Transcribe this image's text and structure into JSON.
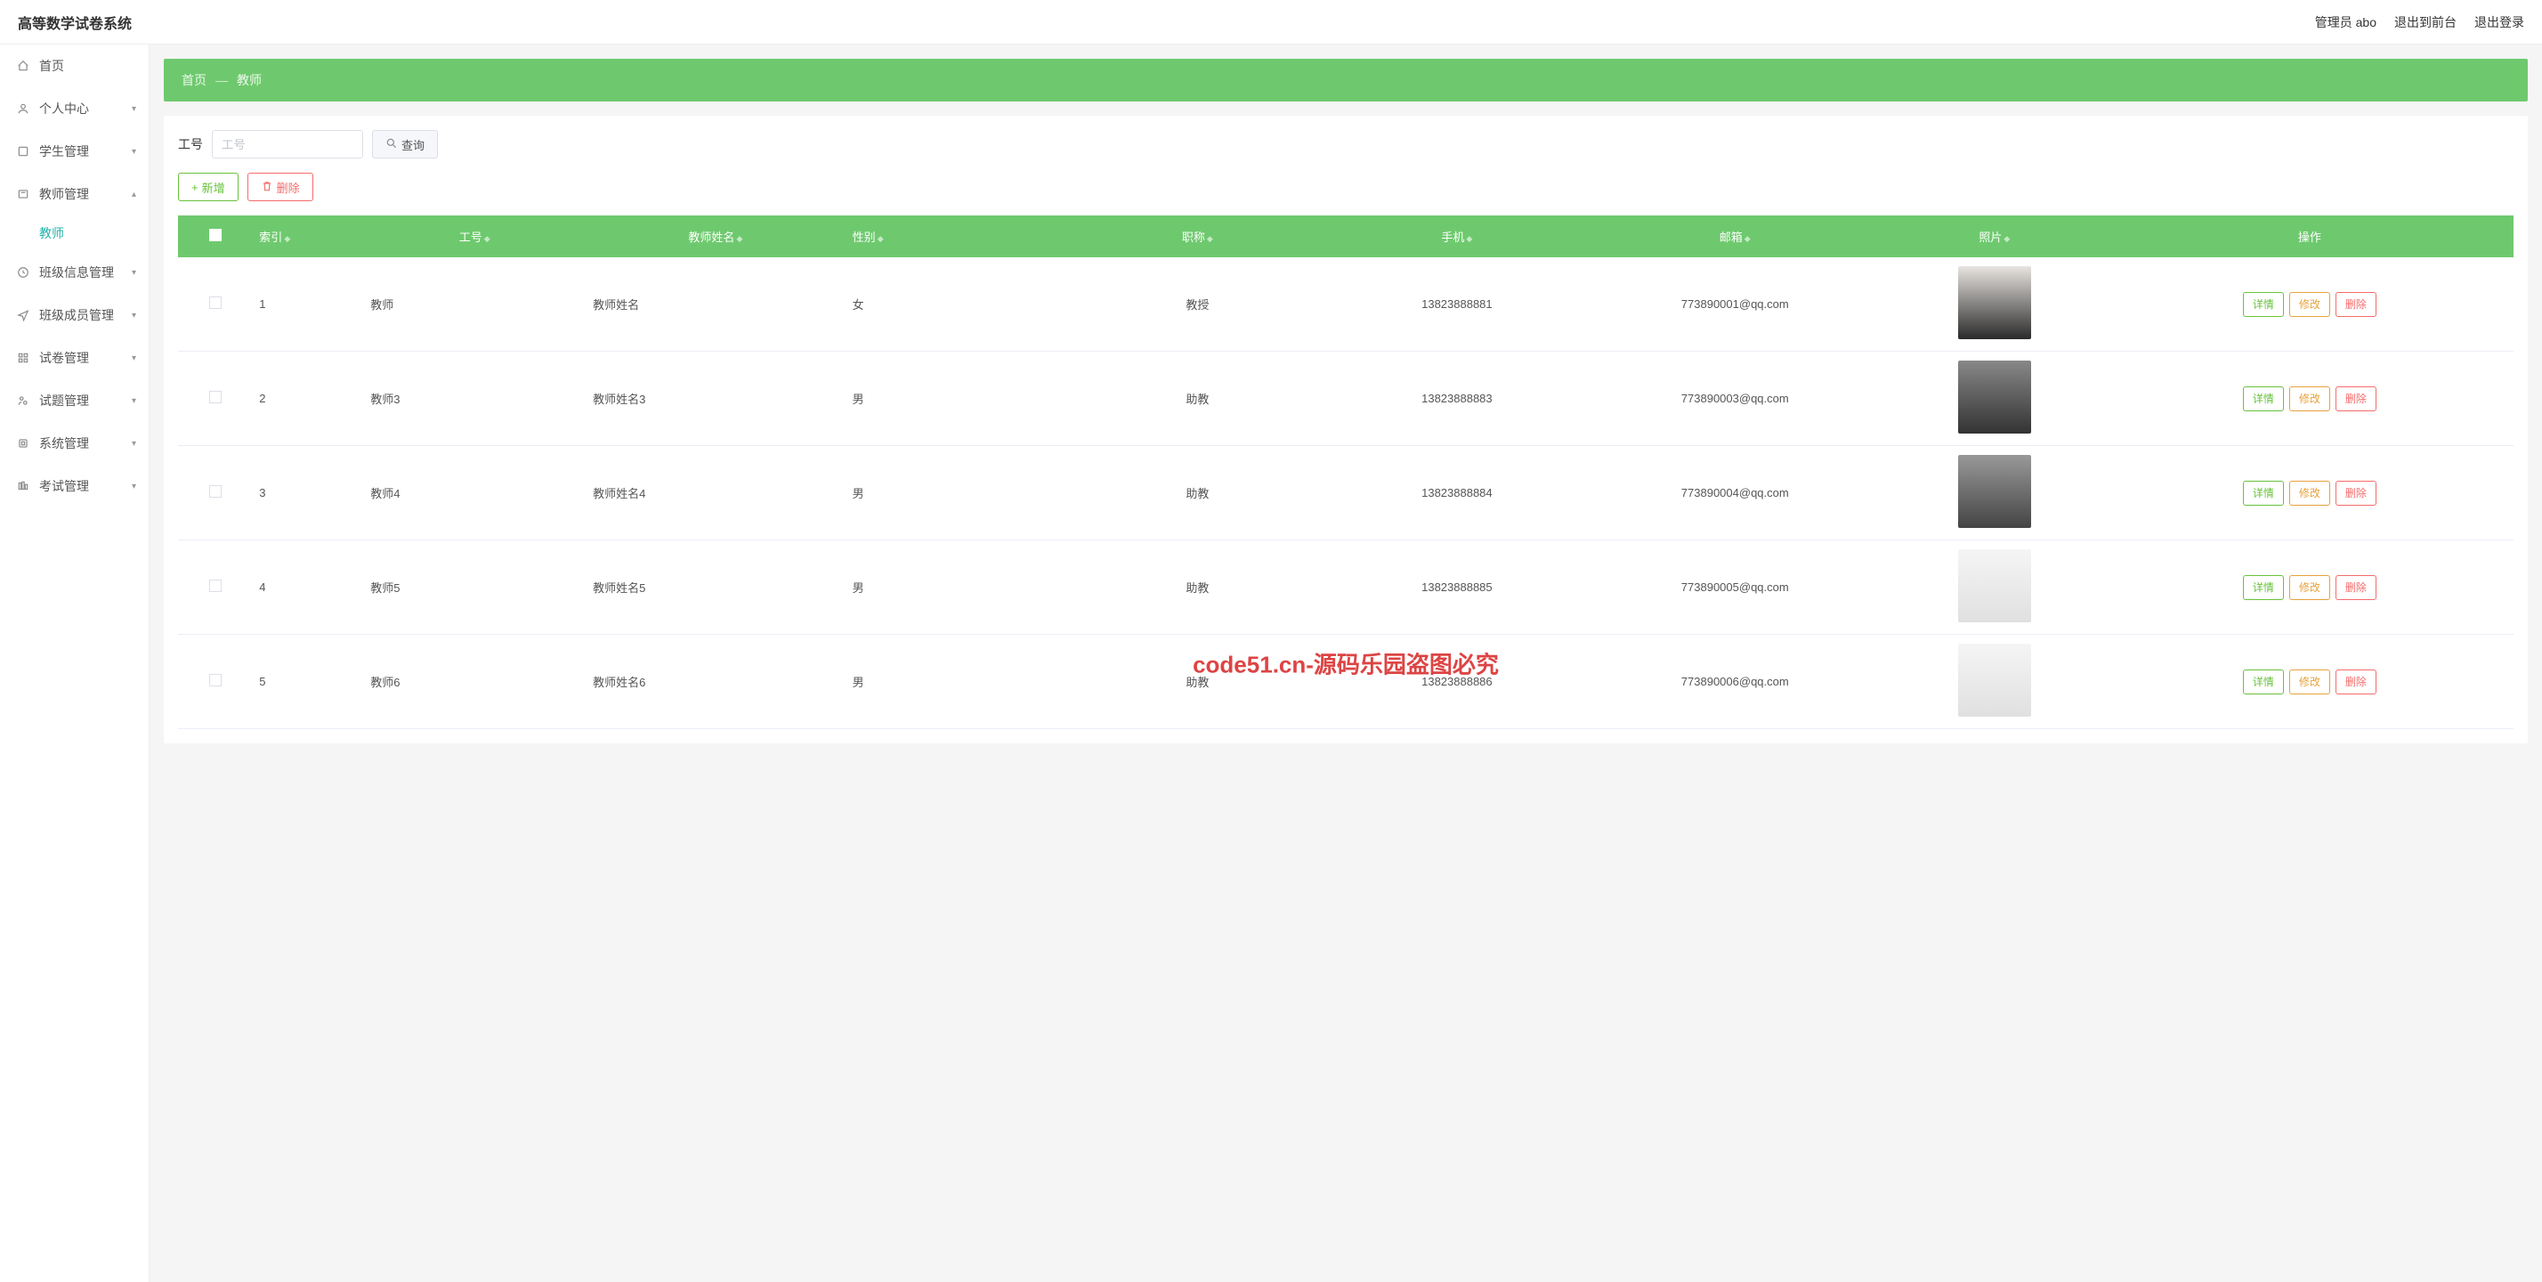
{
  "header": {
    "title": "高等数学试卷系统",
    "admin_label": "管理员 abo",
    "exit_front": "退出到前台",
    "logout": "退出登录"
  },
  "sidebar": {
    "items": [
      {
        "label": "首页",
        "icon": "home-icon",
        "expandable": false
      },
      {
        "label": "个人中心",
        "icon": "user-icon",
        "expandable": true,
        "expanded": false
      },
      {
        "label": "学生管理",
        "icon": "student-icon",
        "expandable": true,
        "expanded": false
      },
      {
        "label": "教师管理",
        "icon": "teacher-icon",
        "expandable": true,
        "expanded": true,
        "children": [
          {
            "label": "教师"
          }
        ]
      },
      {
        "label": "班级信息管理",
        "icon": "class-icon",
        "expandable": true,
        "expanded": false
      },
      {
        "label": "班级成员管理",
        "icon": "member-icon",
        "expandable": true,
        "expanded": false
      },
      {
        "label": "试卷管理",
        "icon": "paper-icon",
        "expandable": true,
        "expanded": false
      },
      {
        "label": "试题管理",
        "icon": "question-icon",
        "expandable": true,
        "expanded": false
      },
      {
        "label": "系统管理",
        "icon": "system-icon",
        "expandable": true,
        "expanded": false
      },
      {
        "label": "考试管理",
        "icon": "exam-icon",
        "expandable": true,
        "expanded": false
      }
    ]
  },
  "breadcrumb": {
    "home": "首页",
    "current": "教师"
  },
  "search": {
    "label": "工号",
    "placeholder": "工号",
    "btn": "查询"
  },
  "actions": {
    "add": "新增",
    "delete": "删除"
  },
  "table": {
    "headers": [
      "索引",
      "工号",
      "教师姓名",
      "性别",
      "职称",
      "手机",
      "邮箱",
      "照片",
      "操作"
    ],
    "row_actions": {
      "detail": "详情",
      "edit": "修改",
      "delete": "删除"
    },
    "rows": [
      {
        "idx": "1",
        "work_id": "教师",
        "name": "教师姓名",
        "gender": "女",
        "title": "教授",
        "phone": "13823888881",
        "email": "773890001@qq.com"
      },
      {
        "idx": "2",
        "work_id": "教师3",
        "name": "教师姓名3",
        "gender": "男",
        "title": "助教",
        "phone": "13823888883",
        "email": "773890003@qq.com"
      },
      {
        "idx": "3",
        "work_id": "教师4",
        "name": "教师姓名4",
        "gender": "男",
        "title": "助教",
        "phone": "13823888884",
        "email": "773890004@qq.com"
      },
      {
        "idx": "4",
        "work_id": "教师5",
        "name": "教师姓名5",
        "gender": "男",
        "title": "助教",
        "phone": "13823888885",
        "email": "773890005@qq.com"
      },
      {
        "idx": "5",
        "work_id": "教师6",
        "name": "教师姓名6",
        "gender": "男",
        "title": "助教",
        "phone": "13823888886",
        "email": "773890006@qq.com"
      }
    ]
  },
  "watermark": "code51.cn-源码乐园盗图必究"
}
